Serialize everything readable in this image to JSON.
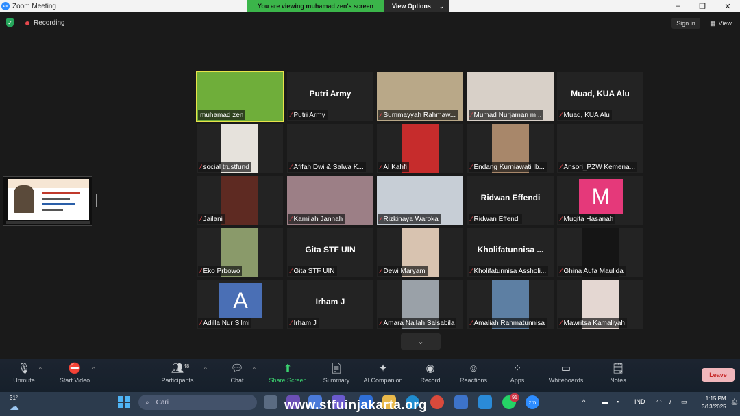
{
  "window": {
    "title": "Zoom Meeting",
    "minimize": "–",
    "maximize": "❐",
    "close": "✕"
  },
  "banner": {
    "viewing": "You are viewing muhamad zen's screen",
    "view_options": "View Options",
    "chevron": "⌄"
  },
  "status": {
    "recording": "Recording",
    "sign_in": "Sign in",
    "view": "View"
  },
  "participants": [
    {
      "name": "muhamad zen",
      "type": "video",
      "bg": "#6fae3a",
      "active": true
    },
    {
      "name": "Putri Army",
      "type": "name",
      "center": "Putri Army"
    },
    {
      "name": "Summayyah Rahmaw...",
      "type": "video",
      "bg": "#b9a888"
    },
    {
      "name": "Mumad Nurjaman m...",
      "type": "video",
      "bg": "#d8d0c8"
    },
    {
      "name": "Muad,  KUA Alu",
      "type": "name",
      "center": "Muad,  KUA Alu"
    },
    {
      "name": "social trustfund",
      "type": "video",
      "bg": "#e6e2dc"
    },
    {
      "name": "Afifah Dwi & Salwa K...",
      "type": "blank"
    },
    {
      "name": "Al Kahfi",
      "type": "video",
      "bg": "#c62c2c"
    },
    {
      "name": "Endang Kurniawati Ib...",
      "type": "video",
      "bg": "#a8876a"
    },
    {
      "name": "Ansori_PZW Kemena...",
      "type": "blank"
    },
    {
      "name": "Jailani",
      "type": "video",
      "bg": "#5e2a22"
    },
    {
      "name": "Kamilah Jannah",
      "type": "video",
      "bg": "#9c7f86"
    },
    {
      "name": "Rizkinaya Waroka",
      "type": "video",
      "bg": "#c7ced6"
    },
    {
      "name": "Ridwan Effendi",
      "type": "name",
      "center": "Ridwan Effendi"
    },
    {
      "name": "Muqita Hasanah",
      "type": "avatar",
      "letter": "M",
      "avatar_bg": "#e5397a"
    },
    {
      "name": "Eko Prbowo",
      "type": "video",
      "bg": "#8a9a6a"
    },
    {
      "name": "Gita STF UIN",
      "type": "name",
      "center": "Gita STF UIN"
    },
    {
      "name": "Dewi Maryam",
      "type": "video",
      "bg": "#d8c3b0"
    },
    {
      "name": "Kholifatunnisa Assholi...",
      "type": "name",
      "center": "Kholifatunnisa ..."
    },
    {
      "name": "Ghina Aufa Maulida",
      "type": "video",
      "bg": "#151515"
    },
    {
      "name": "Adilla Nur Silmi",
      "type": "avatar",
      "letter": "A",
      "avatar_bg": "#4a6fb5"
    },
    {
      "name": "Irham J",
      "type": "name",
      "center": "Irham J"
    },
    {
      "name": "Amara Nailah Salsabila",
      "type": "video",
      "bg": "#9aa1a8"
    },
    {
      "name": "Amaliah Rahmatunnisa",
      "type": "video",
      "bg": "#5d7fa3"
    },
    {
      "name": "Mawritsa Kamaliyah",
      "type": "video",
      "bg": "#e4d7d2"
    }
  ],
  "toolbar": {
    "unmute": "Unmute",
    "start_video": "Start Video",
    "participants": "Participants",
    "participant_count": "48",
    "chat": "Chat",
    "share_screen": "Share Screen",
    "summary": "Summary",
    "ai_companion": "AI Companion",
    "record": "Record",
    "reactions": "Reactions",
    "apps": "Apps",
    "whiteboards": "Whiteboards",
    "notes": "Notes",
    "leave": "Leave"
  },
  "taskbar": {
    "weather": "31°",
    "search_placeholder": "Cari",
    "whatsapp_badge": "91",
    "lang": "IND",
    "time": "1:15 PM",
    "date": "3/13/2025",
    "zoom_label": "zm"
  },
  "watermark": "www.stfuinjakarta.org",
  "colors": {
    "accent_green": "#3bb54a",
    "active_border": "#e8e34a",
    "mic_muted": "#e5484d",
    "leave_text": "#c62828"
  }
}
